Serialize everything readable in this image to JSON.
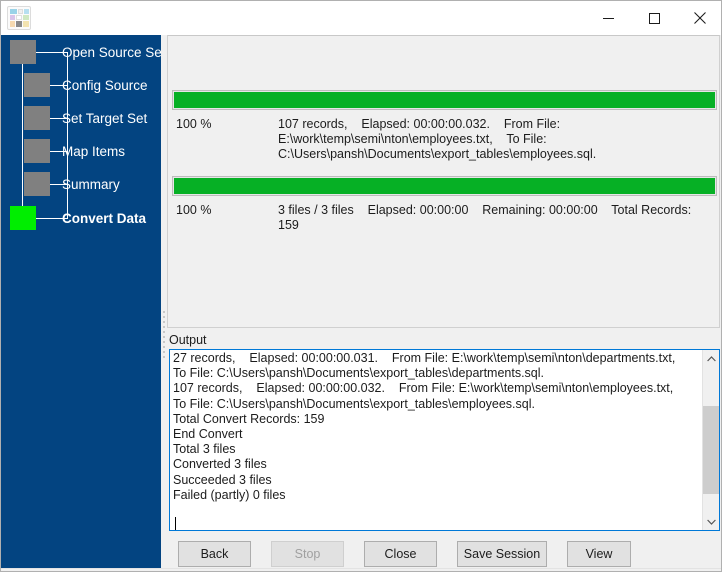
{
  "window": {
    "title": "",
    "icon_name": "app-icon",
    "controls": {
      "minimize": "─",
      "maximize": "☐",
      "close": "✕"
    }
  },
  "colors": {
    "sidebar_blue": "#034481",
    "step_done": "#808080",
    "step_active": "#00ee00",
    "progress_green": "#06b025",
    "focus_border": "#0078d7",
    "panel_bg": "#f0f0f0"
  },
  "sidebar": {
    "steps": [
      {
        "label": "Open Source Set",
        "state": "done"
      },
      {
        "label": "Config Source",
        "state": "done"
      },
      {
        "label": "Set Target Set",
        "state": "done"
      },
      {
        "label": "Map Items",
        "state": "done"
      },
      {
        "label": "Summary",
        "state": "done"
      },
      {
        "label": "Convert Data",
        "state": "active"
      }
    ]
  },
  "progress": {
    "file_task": {
      "percent_label": "100 %",
      "percent_value": 100,
      "detail": "107 records,    Elapsed: 00:00:00.032.    From File: E:\\work\\temp\\semi\\nton\\employees.txt,    To File: C:\\Users\\pansh\\Documents\\export_tables\\employees.sql."
    },
    "overall_task": {
      "percent_label": "100 %",
      "percent_value": 100,
      "detail": "3 files / 3 files    Elapsed: 00:00:00    Remaining: 00:00:00    Total Records: 159"
    }
  },
  "output": {
    "label": "Output",
    "text": "27 records,    Elapsed: 00:00:00.031.    From File: E:\\work\\temp\\semi\\nton\\departments.txt,    To File: C:\\Users\\pansh\\Documents\\export_tables\\departments.sql.\n107 records,    Elapsed: 00:00:00.032.    From File: E:\\work\\temp\\semi\\nton\\employees.txt,    To File: C:\\Users\\pansh\\Documents\\export_tables\\employees.sql.\nTotal Convert Records: 159\nEnd Convert\nTotal 3 files\nConverted 3 files\nSucceeded 3 files\nFailed (partly) 0 files\n"
  },
  "buttons": {
    "back": "Back",
    "stop": "Stop",
    "close": "Close",
    "save_session": "Save Session",
    "view": "View"
  }
}
